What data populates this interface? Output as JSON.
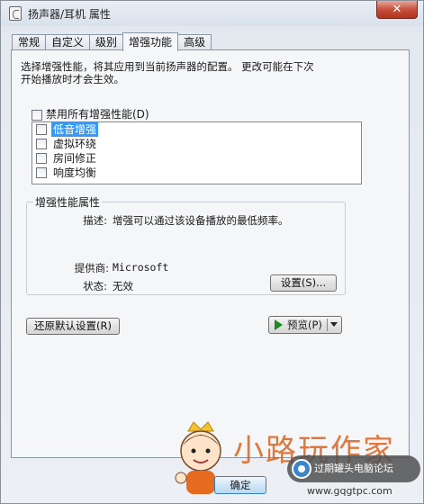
{
  "window": {
    "title": "扬声器/耳机 属性",
    "close_glyph": "✕"
  },
  "tabs": [
    {
      "label": "常规",
      "active": false
    },
    {
      "label": "自定义",
      "active": false
    },
    {
      "label": "级别",
      "active": false
    },
    {
      "label": "增强功能",
      "active": true
    },
    {
      "label": "高级",
      "active": false
    }
  ],
  "enhancements": {
    "description_line1": "选择增强性能，将其应用到当前扬声器的配置。  更改可能在下次",
    "description_line2": "开始播放时才会生效。",
    "disable_all_label": "禁用所有增强性能(D)",
    "disable_all_checked": false,
    "items": [
      {
        "label": "低音增强",
        "checked": false,
        "selected": true
      },
      {
        "label": "虚拟环绕",
        "checked": false,
        "selected": false
      },
      {
        "label": "房间修正",
        "checked": false,
        "selected": false
      },
      {
        "label": "响度均衡",
        "checked": false,
        "selected": false
      }
    ]
  },
  "properties": {
    "group_title": "增强性能属性",
    "description_label": "描述:",
    "description_value": "增强可以通过该设备播放的最低频率。",
    "provider_label": "提供商:",
    "provider_value": "Microsoft",
    "status_label": "状态:",
    "status_value": "无效",
    "settings_button": "设置(S)..."
  },
  "buttons": {
    "restore_defaults": "还原默认设置(R)",
    "preview": "预览(P)",
    "ok": "确定"
  },
  "overlay": {
    "watermark_text": "小路玩作家",
    "forum_badge": "过期罐头电脑论坛",
    "site_url": "www.gqgtpc.com"
  },
  "colors": {
    "selection": "#3399ff",
    "play_icon": "#1e8a1e",
    "close_button": "#c7503c",
    "watermark": "#d85a13"
  }
}
